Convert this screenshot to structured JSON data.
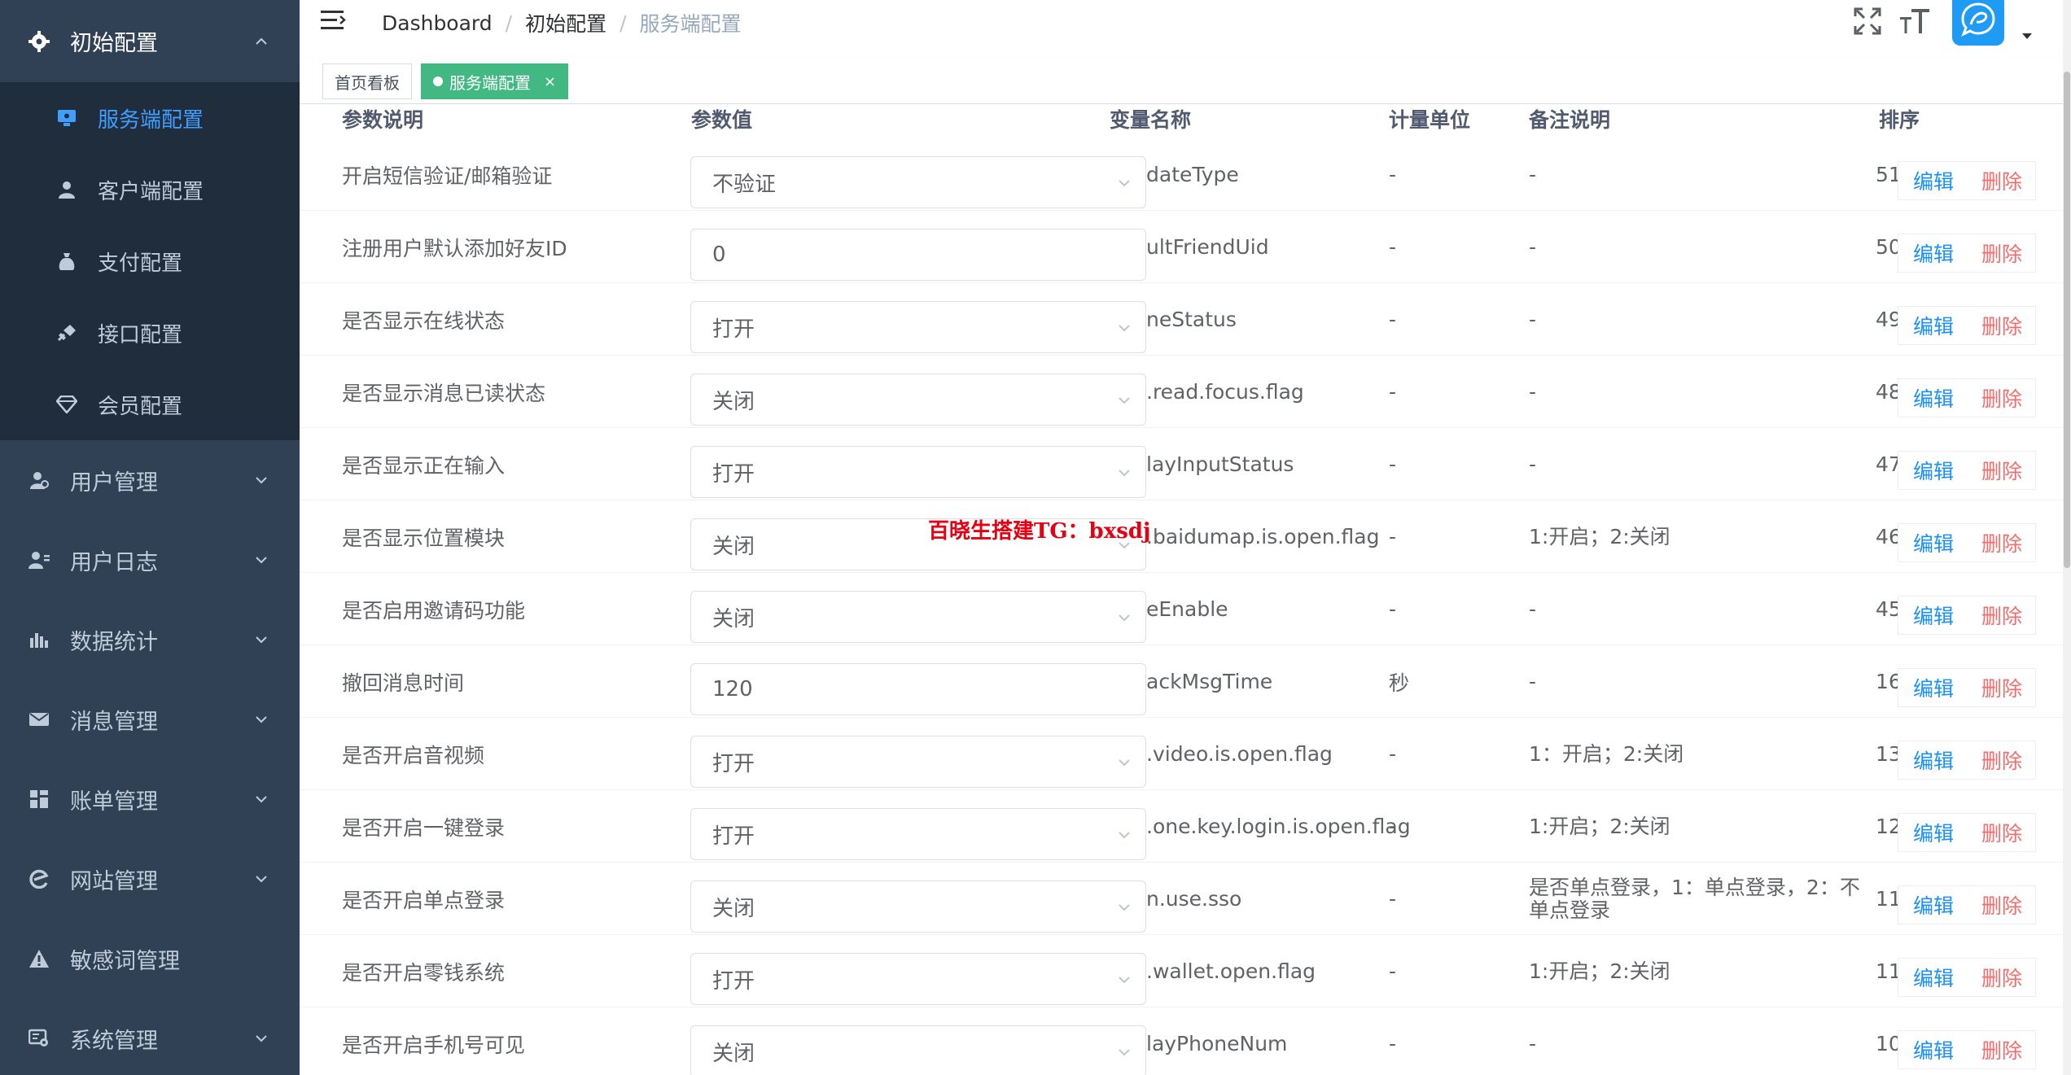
{
  "sidebar": {
    "group_active": {
      "label": "初始配置",
      "icon": "gear-icon"
    },
    "sub_items": [
      {
        "label": "服务端配置",
        "icon": "monitor-icon",
        "active": true
      },
      {
        "label": "客户端配置",
        "icon": "user-icon",
        "active": false
      },
      {
        "label": "支付配置",
        "icon": "bag-icon",
        "active": false
      },
      {
        "label": "接口配置",
        "icon": "link-icon",
        "active": false
      },
      {
        "label": "会员配置",
        "icon": "diamond-icon",
        "active": false
      }
    ],
    "menus": [
      {
        "label": "用户管理",
        "icon": "user-manage-icon"
      },
      {
        "label": "用户日志",
        "icon": "user-log-icon"
      },
      {
        "label": "数据统计",
        "icon": "bar-chart-icon"
      },
      {
        "label": "消息管理",
        "icon": "mail-icon"
      },
      {
        "label": "账单管理",
        "icon": "grid-icon"
      },
      {
        "label": "网站管理",
        "icon": "browser-icon"
      },
      {
        "label": "敏感词管理",
        "icon": "warning-icon"
      },
      {
        "label": "系统管理",
        "icon": "system-icon"
      }
    ]
  },
  "navbar": {
    "breadcrumb": [
      "Dashboard",
      "初始配置",
      "服务端配置"
    ],
    "tools": [
      "fullscreen-icon",
      "font-size-icon"
    ]
  },
  "tags": {
    "items": [
      {
        "label": "首页看板",
        "active": false
      },
      {
        "label": "服务端配置",
        "active": true,
        "close": "×"
      }
    ]
  },
  "table": {
    "headers": {
      "desc": "参数说明",
      "value": "参数值",
      "var": "变量名称",
      "unit": "计量单位",
      "remark": "备注说明",
      "sort": "排序"
    },
    "actions": {
      "edit": "编辑",
      "delete": "删除"
    },
    "rows": [
      {
        "desc": "开启短信验证/邮箱验证",
        "value": "不验证",
        "type": "select",
        "var": "dateType",
        "unit": "-",
        "remark": "-",
        "sort": "51"
      },
      {
        "desc": "注册用户默认添加好友ID",
        "value": "0",
        "type": "input",
        "var": "ultFriendUid",
        "unit": "-",
        "remark": "-",
        "sort": "50"
      },
      {
        "desc": "是否显示在线状态",
        "value": "打开",
        "type": "select",
        "var": "neStatus",
        "unit": "-",
        "remark": "-",
        "sort": "49"
      },
      {
        "desc": "是否显示消息已读状态",
        "value": "关闭",
        "type": "select",
        "var": ".read.focus.flag",
        "unit": "-",
        "remark": "-",
        "sort": "48"
      },
      {
        "desc": "是否显示正在输入",
        "value": "打开",
        "type": "select",
        "var": "layInputStatus",
        "unit": "-",
        "remark": "-",
        "sort": "47"
      },
      {
        "desc": "是否显示位置模块",
        "value": "关闭",
        "type": "select",
        "var": ".baidumap.is.open.flag",
        "unit": "-",
        "remark": "1:开启；2:关闭",
        "sort": "46"
      },
      {
        "desc": "是否启用邀请码功能",
        "value": "关闭",
        "type": "select",
        "var": "eEnable",
        "unit": "-",
        "remark": "-",
        "sort": "45"
      },
      {
        "desc": "撤回消息时间",
        "value": "120",
        "type": "input",
        "var": "ackMsgTime",
        "unit": "秒",
        "remark": "-",
        "sort": "16"
      },
      {
        "desc": "是否开启音视频",
        "value": "打开",
        "type": "select",
        "var": ".video.is.open.flag",
        "unit": "-",
        "remark": "1：开启；2:关闭",
        "sort": "13"
      },
      {
        "desc": "是否开启一键登录",
        "value": "打开",
        "type": "select",
        "var": ".one.key.login.is.open.flag",
        "unit": "-",
        "remark": "1:开启；2:关闭",
        "sort": "12"
      },
      {
        "desc": "是否开启单点登录",
        "value": "关闭",
        "type": "select",
        "var": "n.use.sso",
        "unit": "-",
        "remark": "是否单点登录，1：单点登录，2：不单点登录",
        "sort": "11"
      },
      {
        "desc": "是否开启零钱系统",
        "value": "打开",
        "type": "select",
        "var": ".wallet.open.flag",
        "unit": "-",
        "remark": "1:开启；2:关闭",
        "sort": "11"
      },
      {
        "desc": "是否开启手机号可见",
        "value": "关闭",
        "type": "select",
        "var": "layPhoneNum",
        "unit": "-",
        "remark": "-",
        "sort": "10"
      }
    ]
  },
  "watermark": "百晓生搭建TG：bxsdj",
  "colors": {
    "sidebar_bg": "#304156",
    "submenu_bg": "#1f2d3d",
    "active_blue": "#409eff",
    "tag_green": "#42b983",
    "edit_blue": "#1890ff",
    "delete_red": "#f56c6c",
    "watermark_red": "#e60012"
  }
}
